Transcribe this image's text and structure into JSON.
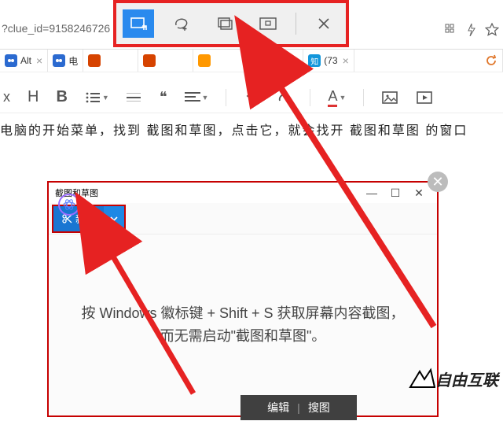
{
  "url_fragment": "?clue_id=9158246726",
  "snip_toolbar": {
    "modes": [
      "rectangle",
      "freeform",
      "window",
      "fullscreen",
      "close"
    ]
  },
  "tabs": [
    {
      "favicon_bg": "#2b6ad0",
      "favicon_text": "",
      "label": "Alt"
    },
    {
      "favicon_bg": "#2b6ad0",
      "favicon_text": "",
      "label": "电"
    },
    {
      "favicon_bg": "#d64300",
      "favicon_text": "",
      "label": ""
    },
    {
      "favicon_bg": "#d64300",
      "favicon_text": "",
      "label": ""
    },
    {
      "favicon_bg": "#ff9800",
      "favicon_text": "",
      "label": ""
    },
    {
      "favicon_bg": "#ff5090",
      "favicon_text": "",
      "label": ""
    },
    {
      "favicon_bg": "#1296db",
      "favicon_text": "知",
      "label": "(73"
    }
  ],
  "formatting": {
    "x_label": "x",
    "h_label": "H",
    "b_label": "B",
    "quote_label": "❝",
    "a_label": "A"
  },
  "article_line": "电脑的开始菜单，找到 截图和草图，点击它，就会找开 截图和草图 的窗口",
  "snipwin": {
    "title": "截图和草图",
    "min": "—",
    "max": "☐",
    "close": "✕",
    "new_label": "新建",
    "hint_l1": "按 Windows 徽标键 + Shift + S 获取屏幕内容截图，",
    "hint_l2": "而无需启动\"截图和草图\"。"
  },
  "edit_bar": {
    "edit": "编辑",
    "search": "搜图"
  },
  "watermark": "自由互联",
  "close_badge": "✕"
}
